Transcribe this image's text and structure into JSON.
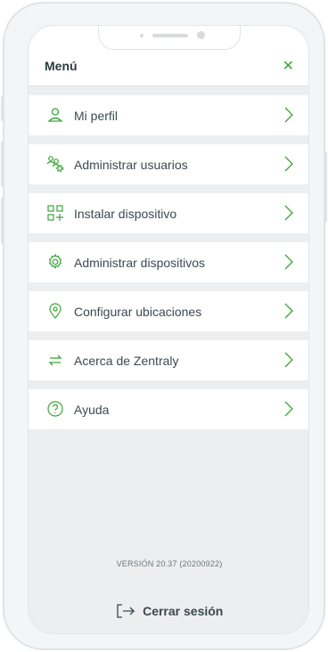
{
  "header": {
    "title": "Menú",
    "close_icon": "close-icon"
  },
  "menu": {
    "items": [
      {
        "label": "Mi perfil",
        "icon": "user-icon"
      },
      {
        "label": "Administrar usuarios",
        "icon": "users-gear-icon"
      },
      {
        "label": "Instalar dispositivo",
        "icon": "add-device-icon"
      },
      {
        "label": "Administrar dispositivos",
        "icon": "gear-icon"
      },
      {
        "label": "Configurar ubicaciones",
        "icon": "location-pin-icon"
      },
      {
        "label": "Acerca de Zentraly",
        "icon": "swap-arrows-icon"
      },
      {
        "label": "Ayuda",
        "icon": "help-icon"
      }
    ]
  },
  "footer": {
    "version": "VERSIÓN 20.37 (20200922)",
    "logout_label": "Cerrar sesión",
    "logout_icon": "logout-icon"
  },
  "colors": {
    "accent": "#3ca43a",
    "text": "#3a4a50",
    "background": "#eceef0"
  }
}
